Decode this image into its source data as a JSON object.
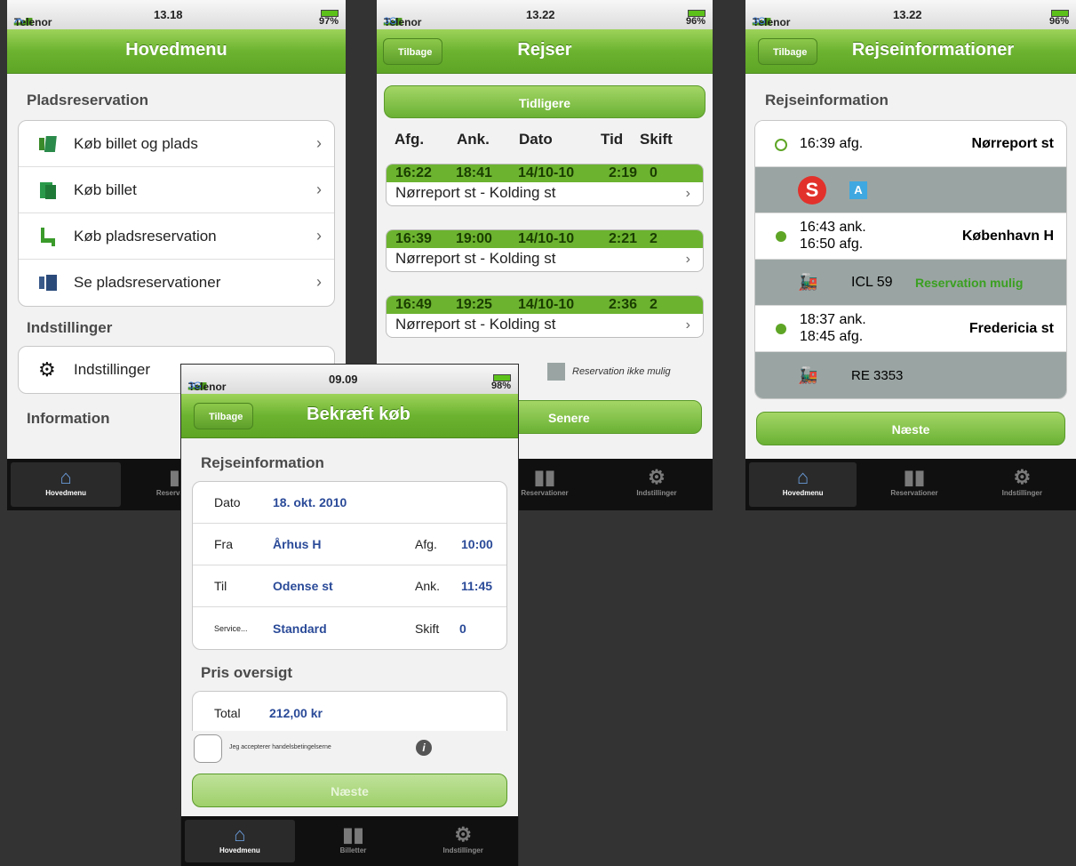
{
  "s1": {
    "status": {
      "carrier": "Telenor DK",
      "time": "13.18",
      "battery": "97%"
    },
    "title": "Hovedmenu",
    "section1": "Pladsreservation",
    "items": [
      "Køb billet og plads",
      "Køb billet",
      "Køb pladsreservation",
      "Se pladsreservationer"
    ],
    "section2": "Indstillinger",
    "settings_item": "Indstillinger",
    "section3": "Information",
    "tabs": [
      "Hovedmenu",
      "Reservationer"
    ]
  },
  "s2": {
    "status": {
      "carrier": "Telenor DK",
      "network": "3G",
      "time": "13.22",
      "battery": "96%"
    },
    "back": "Tilbage",
    "title": "Rejser",
    "earlier": "Tidligere",
    "headers": [
      "Afg.",
      "Ank.",
      "Dato",
      "Tid",
      "Skift"
    ],
    "trips": [
      {
        "dep": "16:22",
        "arr": "18:41",
        "date": "14/10-10",
        "dur": "2:19",
        "changes": "0",
        "route": "Nørreport st - Kolding st"
      },
      {
        "dep": "16:39",
        "arr": "19:00",
        "date": "14/10-10",
        "dur": "2:21",
        "changes": "2",
        "route": "Nørreport st - Kolding st"
      },
      {
        "dep": "16:49",
        "arr": "19:25",
        "date": "14/10-10",
        "dur": "2:36",
        "changes": "2",
        "route": "Nørreport st - Kolding st"
      }
    ],
    "legend_no": "Reservation ikke mulig",
    "later": "Senere",
    "tabs": [
      "Reservationer",
      "Indstillinger"
    ]
  },
  "s3": {
    "status": {
      "carrier": "Telenor DK",
      "network": "3G",
      "time": "13.22",
      "battery": "96%"
    },
    "back": "Tilbage",
    "title": "Rejseinformationer",
    "section": "Rejseinformation",
    "stops": [
      {
        "times": [
          "16:39 afg."
        ],
        "station": "Nørreport st"
      },
      {
        "times": [
          "16:43 ank.",
          "16:50 afg."
        ],
        "station": "København H"
      },
      {
        "times": [
          "18:37 ank.",
          "18:45 afg."
        ],
        "station": "Fredericia st"
      }
    ],
    "legs": [
      {
        "badge1": "S",
        "badge2": "A"
      },
      {
        "train": "ICL 59",
        "note": "Reservation mulig"
      },
      {
        "train": "RE 3353"
      }
    ],
    "next": "Næste",
    "tabs": [
      "Hovedmenu",
      "Reservationer",
      "Indstillinger"
    ]
  },
  "s4": {
    "status": {
      "carrier": "Telenor DK",
      "network": "3G",
      "time": "09.09",
      "battery": "98%"
    },
    "back": "Tilbage",
    "title": "Bekræft køb",
    "section1": "Rejseinformation",
    "date_k": "Dato",
    "date_v": "18. okt. 2010",
    "from_k": "Fra",
    "from_v": "Århus H",
    "dep_k": "Afg.",
    "dep_v": "10:00",
    "to_k": "Til",
    "to_v": "Odense st",
    "arr_k": "Ank.",
    "arr_v": "11:45",
    "svc_k": "Service...",
    "svc_v": "Standard",
    "chg_k": "Skift",
    "chg_v": "0",
    "section2": "Pris oversigt",
    "total_k": "Total",
    "total_v": "212,00 kr",
    "accept": "Jeg accepterer handelsbetingelserne",
    "next": "Næste",
    "tabs": [
      "Hovedmenu",
      "Billetter",
      "Indstillinger"
    ]
  }
}
